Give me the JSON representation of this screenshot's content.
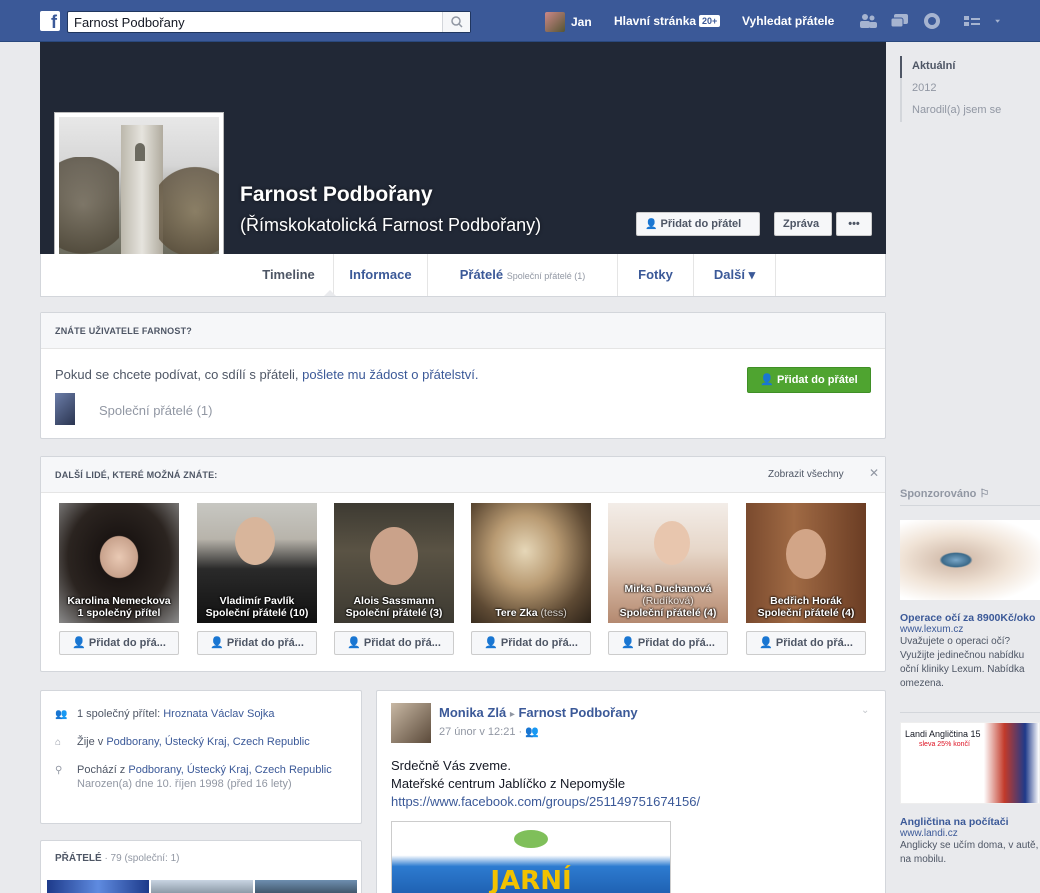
{
  "topbar": {
    "logo": "f",
    "search_value": "Farnost Podbořany",
    "user_name": "Jan",
    "home_label": "Hlavní stránka",
    "home_badge": "20+",
    "find_friends_label": "Vyhledat přátele"
  },
  "profile": {
    "name": "Farnost Podbořany",
    "alt_name": "(Římskokatolická Farnost Podbořany)",
    "add_friend_label": "Přidat do přátel",
    "message_label": "Zpráva",
    "more_label": "•••"
  },
  "tabs": {
    "timeline": "Timeline",
    "info": "Informace",
    "friends": "Přátelé",
    "friends_sub": "Společní přátelé (1)",
    "photos": "Fotky",
    "more": "Další ▾"
  },
  "rail": {
    "items": [
      "Aktuální",
      "2012",
      "Narodil(a) jsem se"
    ]
  },
  "know_card": {
    "heading": "ZNÁTE UŽIVATELE FARNOST?",
    "text_prefix": "Pokud se chcete podívat, co sdílí s přáteli, ",
    "text_link": "pošlete mu žádost o přátelství.",
    "button_label": "Přidat do přátel",
    "mutual_label": "Společní přátelé (1)"
  },
  "people_card": {
    "heading": "DALŠÍ LIDÉ, KTERÉ MOŽNÁ ZNÁTE:",
    "show_all": "Zobrazit všechny",
    "close": "✕",
    "add_label": "Přidat do přá...",
    "people": [
      {
        "name": "Karolina Nemeckova",
        "extra": "",
        "mutual": "1 společný přítel"
      },
      {
        "name": "Vladimír Pavlík",
        "extra": "",
        "mutual": "Společní přátelé (10)"
      },
      {
        "name": "Alois Sassmann",
        "extra": "",
        "mutual": "Společní přátelé (3)"
      },
      {
        "name": "Tere Zka",
        "extra": "(tess)",
        "mutual": ""
      },
      {
        "name": "Mirka Duchanová",
        "extra": "(Rudíková)",
        "mutual": "Společní přátelé (4)"
      },
      {
        "name": "Bedřich Horák",
        "extra": "",
        "mutual": "Společní přátelé (4)"
      }
    ]
  },
  "about": {
    "mutual_prefix": "1 společný přítel: ",
    "mutual_names": "Hroznata Václav Sojka",
    "lives_prefix": "Žije v ",
    "lives_place": "Podborany, Ústecký Kraj, Czech Republic",
    "from_prefix": "Pochází z ",
    "from_place": "Podborany, Ústecký Kraj, Czech Republic",
    "born": "Narozen(a) dne 10. říjen 1998 (před 16 lety)"
  },
  "friends_box": {
    "heading": "PŘÁTELÉ",
    "count": " · 79 (společní: 1)"
  },
  "post": {
    "author": "Monika Zlá",
    "arrow": "▸",
    "target": "Farnost Podbořany",
    "time": "27 únor v 12:21 · ",
    "line1": "Srdečně Vás zveme.",
    "line2": "Mateřské centrum Jablíčko z Nepomyšle",
    "link": "https://www.facebook.com/groups/251149751674156/",
    "image_text": "JARNÍ"
  },
  "sponsored": {
    "title": "Sponzorováno",
    "ads": [
      {
        "title": "Operace očí za 8900Kč/oko",
        "url": "www.lexum.cz",
        "text": "Uvažujete o operaci očí? Využijte jedinečnou nabídku oční kliniky Lexum. Nabídka omezena."
      },
      {
        "title": "Angličtina na počítači",
        "url": "www.landi.cz",
        "text": "Anglicky se učím doma, v autě, na mobilu."
      }
    ],
    "ad2_banner": "Landi Angličtina 15",
    "ad2_sub": "sleva 25% končí"
  }
}
